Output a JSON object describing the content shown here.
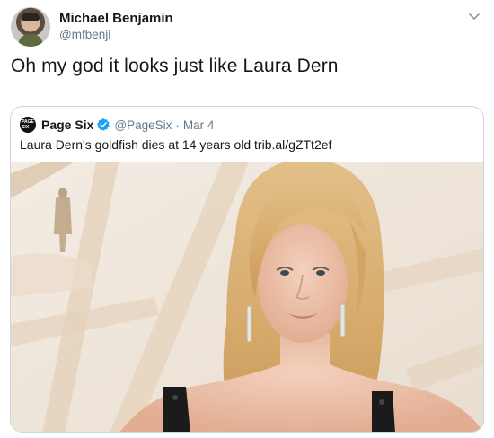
{
  "tweet": {
    "author_name": "Michael Benjamin",
    "author_handle": "@mfbenji",
    "text": "Oh my god it looks just like Laura Dern",
    "menu_icon": "chevron-down-icon"
  },
  "quoted_tweet": {
    "author_name": "Page Six",
    "author_handle": "@PageSix",
    "separator": "·",
    "date": "Mar 4",
    "verified_icon": "verified-badge-icon",
    "verified_color": "#1da1f2",
    "text": "Laura Dern's goldfish dies at 14 years old trib.al/gZTt2ef",
    "image_icon": "photo-of-laura-dern"
  }
}
